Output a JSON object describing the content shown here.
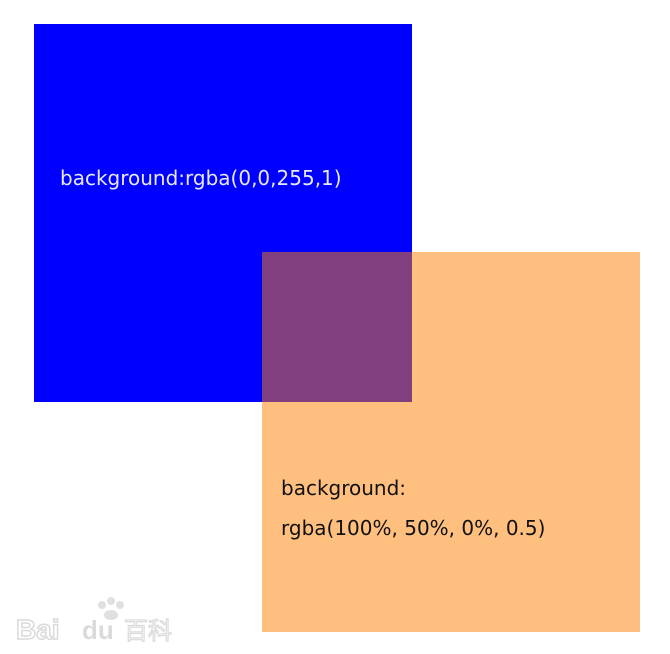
{
  "blue_box": {
    "label": "background:rgba(0,0,255,1)",
    "color": "rgba(0,0,255,1)",
    "text_color": "#e8e8ff"
  },
  "orange_box": {
    "label_line1": "background:",
    "label_line2": "rgba(100%, 50%, 0%, 0.5)",
    "color": "rgba(255,128,0,0.5)",
    "text_color": "#111111"
  },
  "watermark": {
    "text": "Bai du 百科"
  }
}
